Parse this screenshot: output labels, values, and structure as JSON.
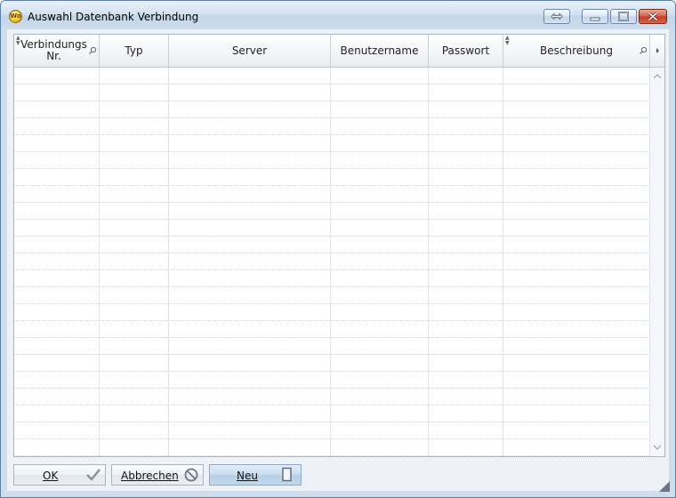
{
  "window": {
    "title": "Auswahl Datenbank Verbindung",
    "app_icon": "wo-coin-icon",
    "app_icon_text": "Wo"
  },
  "titlebar_buttons": [
    {
      "name": "restore-arrows-icon"
    },
    {
      "name": "minimize-icon"
    },
    {
      "name": "maximize-icon"
    },
    {
      "name": "close-icon"
    }
  ],
  "grid": {
    "columns": [
      {
        "label": "Verbindungs Nr.",
        "sortable": true,
        "filterable": true
      },
      {
        "label": "Typ",
        "sortable": false,
        "filterable": false
      },
      {
        "label": "Server",
        "sortable": false,
        "filterable": false
      },
      {
        "label": "Benutzername",
        "sortable": false,
        "filterable": false
      },
      {
        "label": "Passwort",
        "sortable": false,
        "filterable": false
      },
      {
        "label": "Beschreibung",
        "sortable": true,
        "filterable": true
      }
    ],
    "rows": []
  },
  "buttons": {
    "ok": {
      "label": "OK",
      "icon": "checkmark-icon"
    },
    "cancel": {
      "label": "Abbrechen",
      "icon": "prohibited-icon"
    },
    "new": {
      "label": "Neu",
      "icon": "new-document-icon"
    }
  },
  "colors": {
    "titlebar": "#cddcec",
    "client_background": "#eef2f7",
    "close_button": "#c2391f",
    "new_button": "#c3d8ec"
  }
}
